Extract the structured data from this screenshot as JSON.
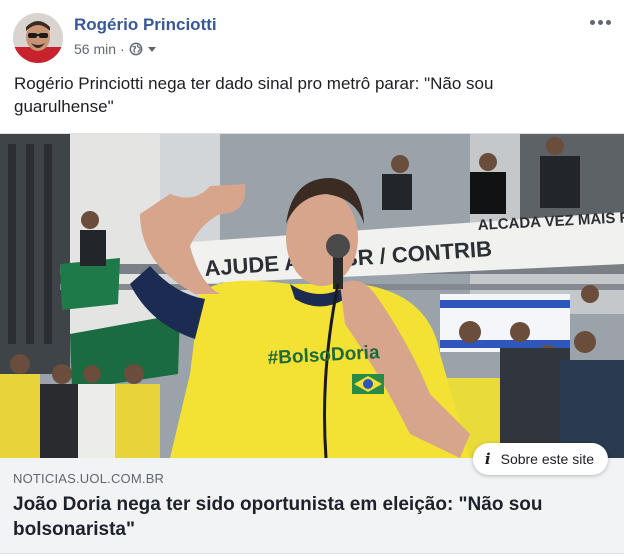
{
  "post": {
    "author": "Rogério Princiotti",
    "time": "56 min",
    "separator": "·",
    "audience_icon": "globe-icon",
    "dropdown_icon": "caret-down-icon",
    "more_icon": "more-options-icon",
    "text": "Rogério Princiotti nega ter dado sinal pro metrô parar: \"Não sou guarulhense\""
  },
  "attachment": {
    "domain": "NOTICIAS.UOL.COM.BR",
    "headline": "João Doria nega ter sido oportunista em eleição: \"Não sou bolsonarista\"",
    "about_site_label": "Sobre este site",
    "about_site_icon": "info-icon",
    "photo": {
      "banner_top": "ALCADA VEZ MAIS FORT",
      "banner_bottom": "AJUDE A DE     BR / CONTRIB",
      "shirt_text": "#BolsoDoria"
    }
  },
  "colors": {
    "link_blue": "#385898",
    "meta_gray": "#616770",
    "caption_bg": "#f2f3f5",
    "shirt_yellow": "#f3e233"
  }
}
